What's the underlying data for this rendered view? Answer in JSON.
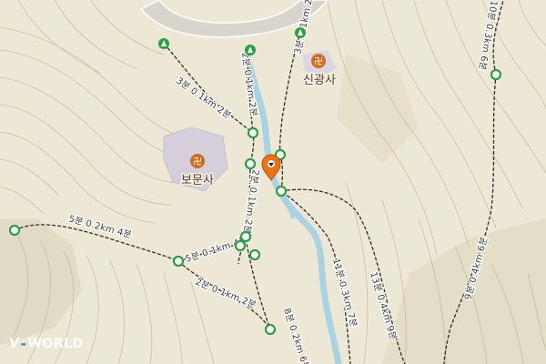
{
  "map": {
    "temples": [
      {
        "name": "신광사",
        "symbol": "卍"
      },
      {
        "name": "보문사",
        "symbol": "卍"
      }
    ],
    "trail_labels": [
      "3분 0.1km 2분",
      "2분 0.1km 2분",
      "3분 0.1km 2분",
      "2분 0.1km 2분",
      "5분 0.2km 4분",
      "5분 0.1km 4분",
      "2분 0.1km 2분",
      "8분 0.2km 6분",
      "11분 0.3km 7분",
      "13분 0.4km 9분",
      "9분 0.4km 6분",
      "10분 0.3km 6분"
    ],
    "colors": {
      "background": "#ede8d5",
      "contour": "#b7ad8e",
      "stream": "#a9d2e2",
      "road": "#d9d5cc",
      "trail": "#2a2a2a",
      "node": "#2f9d45",
      "pin": "#e8731b",
      "temple": "#c96f22"
    },
    "pin_icon": "location-pin-icon",
    "node_icon": "trail-node-icon",
    "start_icon": "trailhead-arrow-icon"
  },
  "brand": {
    "prefix": "V",
    "name": "WORLD"
  }
}
